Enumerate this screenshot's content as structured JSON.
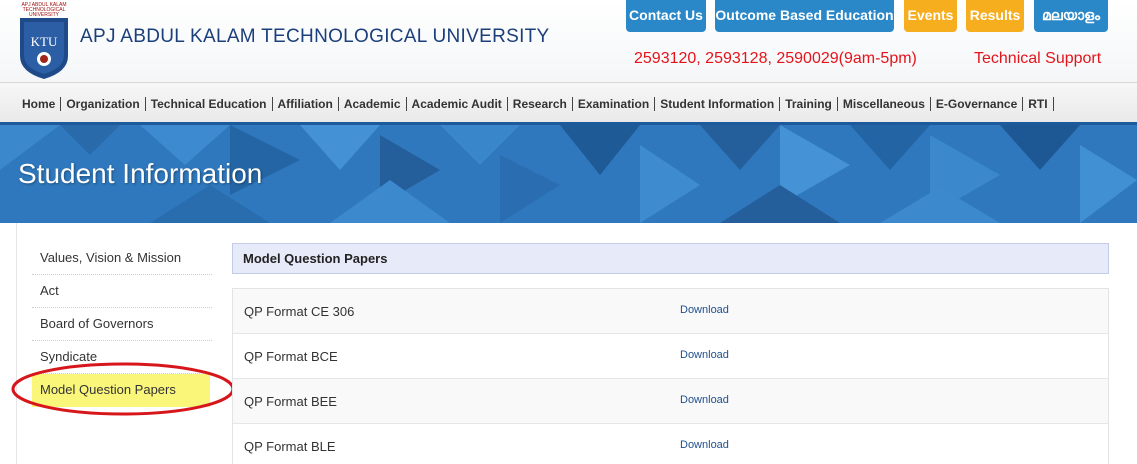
{
  "header": {
    "logo_text": [
      "APJ ABDUL KALAM",
      "TECHNOLOGICAL",
      "UNIVERSITY",
      "KTU"
    ],
    "university_name": "APJ ABDUL KALAM TECHNOLOGICAL UNIVERSITY",
    "phone": "2593120, 2593128, 2590029(9am-5pm)",
    "technical_support": "Technical Support",
    "buttons": {
      "contact": "Contact Us",
      "obe": "Outcome Based Education",
      "events": "Events",
      "results": "Results",
      "malayalam": "മലയാളം"
    }
  },
  "nav": {
    "items": [
      "Home",
      "Organization",
      "Technical Education",
      "Affiliation",
      "Academic",
      "Academic Audit",
      "Research",
      "Examination",
      "Student Information",
      "Training",
      "Miscellaneous",
      "E-Governance",
      "RTI"
    ]
  },
  "banner": {
    "title": "Student Information"
  },
  "sidebar": {
    "items": [
      "Values, Vision & Mission",
      "Act",
      "Board of Governors",
      "Syndicate",
      "Model Question Papers"
    ],
    "active_index": 4
  },
  "content": {
    "title": "Model Question Papers",
    "rows": [
      {
        "name": "QP Format CE 306",
        "link": "Download"
      },
      {
        "name": "QP Format BCE",
        "link": "Download"
      },
      {
        "name": "QP Format BEE",
        "link": "Download"
      },
      {
        "name": "QP Format BLE",
        "link": "Download"
      }
    ]
  },
  "colors": {
    "brand_blue": "#2b88c8",
    "accent_orange": "#f6ad1e",
    "alert_red": "#e4141b",
    "highlight_yellow": "#faf67a",
    "annotation_red": "#d7161c"
  }
}
